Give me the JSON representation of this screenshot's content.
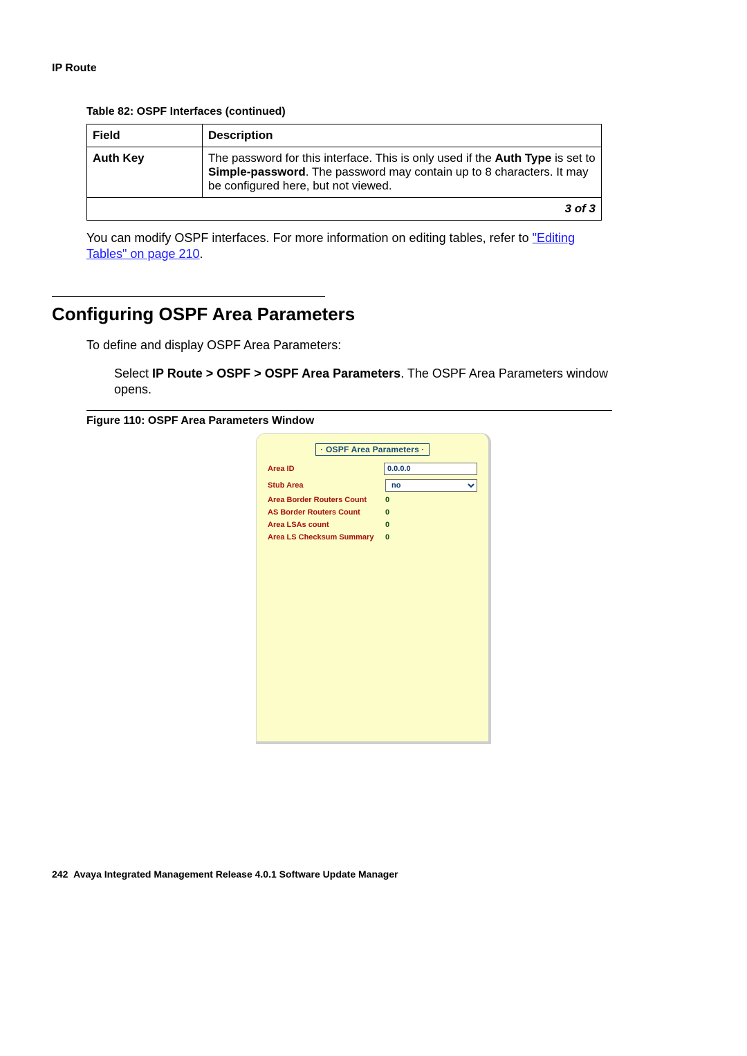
{
  "running_header": "IP Route",
  "table": {
    "caption": "Table 82: OSPF Interfaces (continued)",
    "headers": {
      "field": "Field",
      "description": "Description"
    },
    "row": {
      "field": "Auth Key",
      "desc_pre": "The password for this interface. This is only used if the ",
      "desc_bold1": "Auth Type",
      "desc_mid": " is set to ",
      "desc_bold2": "Simple-password",
      "desc_post": ". The password may contain up to 8 characters. It may be configured here, but not viewed."
    },
    "pager": "3 of 3"
  },
  "para1": {
    "pre": "You can modify OSPF interfaces. For more information on editing tables, refer to ",
    "link": "\"Editing Tables\" on page 210",
    "post": "."
  },
  "section": {
    "title": "Configuring OSPF Area Parameters",
    "intro": "To define and display OSPF Area Parameters:",
    "step_pre": "Select ",
    "step_bold": "IP Route > OSPF > OSPF Area Parameters",
    "step_post": ". The OSPF Area Parameters window opens."
  },
  "figure": {
    "caption": "Figure 110: OSPF Area Parameters Window",
    "dialog_title": "· OSPF Area Parameters ·",
    "rows": {
      "area_id": {
        "label": "Area ID",
        "value": "0.0.0.0"
      },
      "stub_area": {
        "label": "Stub Area",
        "value": "no"
      },
      "abr_count": {
        "label": "Area Border Routers Count",
        "value": "0"
      },
      "asbr_count": {
        "label": "AS Border Routers Count",
        "value": "0"
      },
      "lsa_count": {
        "label": "Area LSAs count",
        "value": "0"
      },
      "ls_checksum": {
        "label": "Area LS Checksum Summary",
        "value": "0"
      }
    }
  },
  "footer": {
    "page": "242",
    "text": "Avaya Integrated Management Release 4.0.1 Software Update Manager"
  }
}
